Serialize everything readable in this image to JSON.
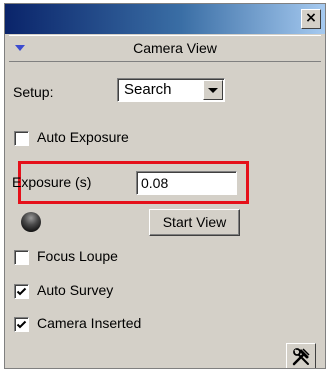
{
  "window": {
    "close_glyph": "×"
  },
  "section": {
    "title": "Camera View",
    "collapse_icon": "triangle-down-icon"
  },
  "setup": {
    "label": "Setup:",
    "selected": "Search"
  },
  "auto_exposure": {
    "label": "Auto Exposure",
    "checked": false
  },
  "exposure": {
    "label": "Exposure (s)",
    "value": "0.08",
    "highlight_color": "#e5101a"
  },
  "status_indicator": {
    "icon": "status-led-icon",
    "color": "#1a1a1a"
  },
  "start_view": {
    "label": "Start View"
  },
  "focus_loupe": {
    "label": "Focus Loupe",
    "checked": false
  },
  "auto_survey": {
    "label": "Auto Survey",
    "checked": true
  },
  "camera_inserted": {
    "label": "Camera Inserted",
    "checked": true
  },
  "tools": {
    "icon": "tools-icon"
  }
}
